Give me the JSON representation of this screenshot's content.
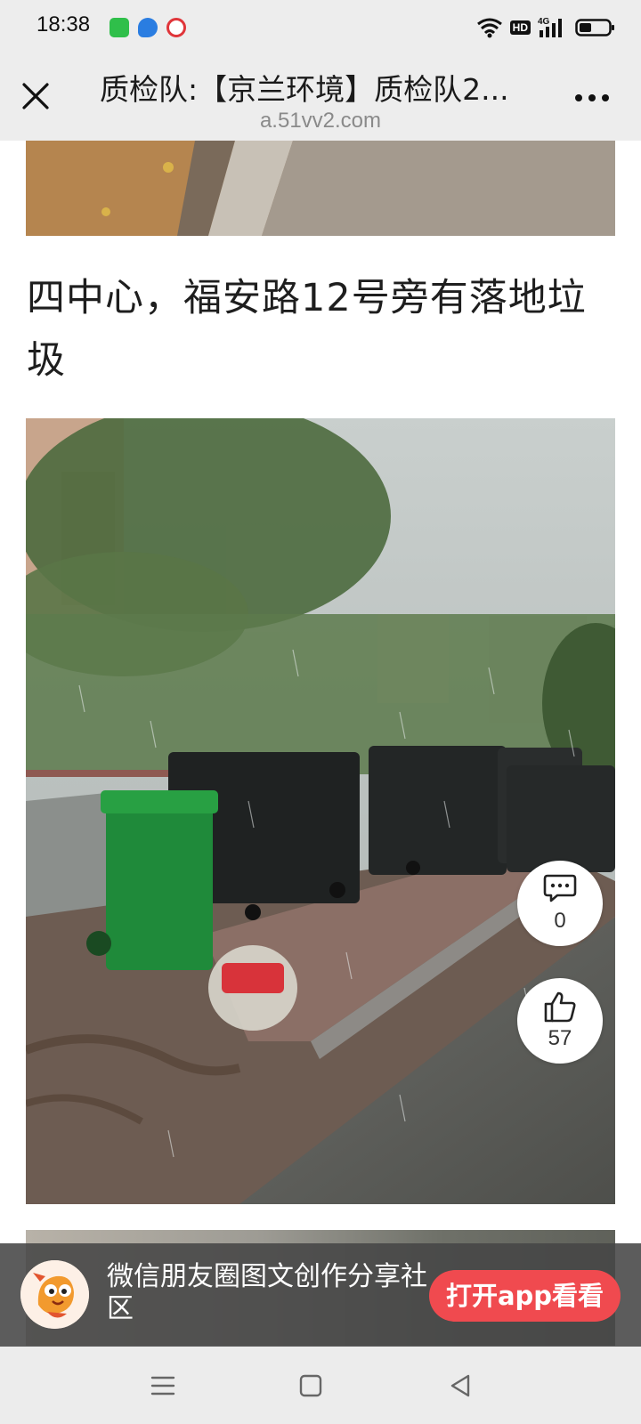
{
  "status_bar": {
    "time": "18:38",
    "apps": [
      {
        "icon": "green-app-icon",
        "color": "#2fbf4a"
      },
      {
        "icon": "blue-app-icon",
        "color": "#2a7de1"
      },
      {
        "icon": "red-app-icon",
        "color": "#e0353a"
      }
    ],
    "hd_label": "HD",
    "network_label": "4G",
    "icons": [
      "wifi-icon",
      "signal-icon",
      "battery-icon"
    ]
  },
  "title_bar": {
    "title": "质检队:【京兰环境】质检队2...",
    "url": "a.51vv2.com",
    "close_icon": "close-icon",
    "more_icon": "more-icon"
  },
  "content": {
    "caption": "四中心，福安路12号旁有落地垃圾",
    "comment_count": "0",
    "like_count": "57"
  },
  "promo": {
    "text": "微信朋友圈图文创作分享社区",
    "button": "打开app看看",
    "button_color": "#f04a4f"
  },
  "nav_bar": {
    "icons": [
      "menu-icon",
      "home-icon",
      "back-icon"
    ]
  }
}
